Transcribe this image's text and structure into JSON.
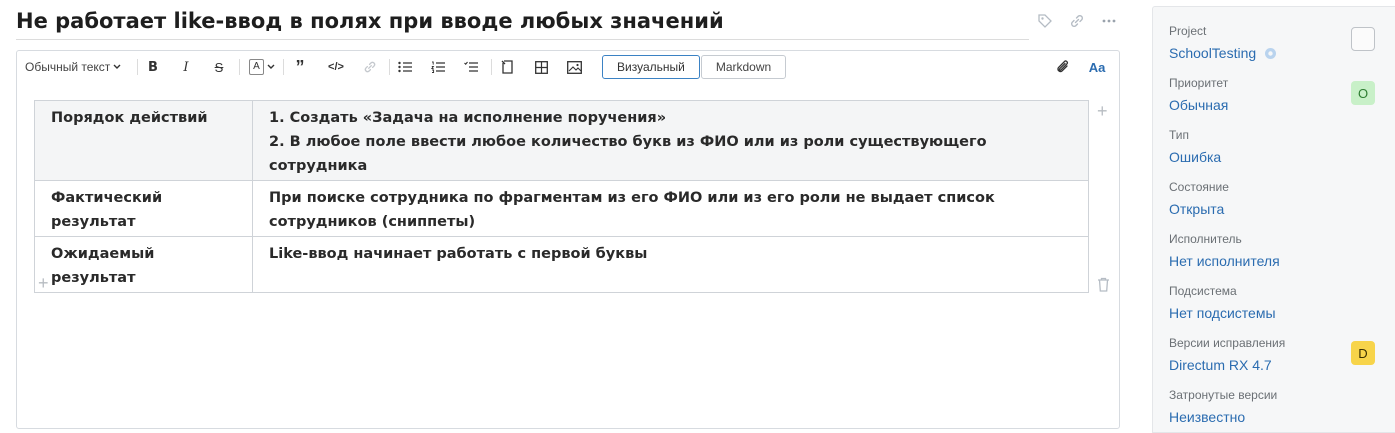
{
  "issue": {
    "title": "Не работает like-ввод в полях при вводе любых значений"
  },
  "toolbar": {
    "style_select": "Обычный текст",
    "modes": [
      "Визуальный",
      "Markdown"
    ],
    "font_toggle": "Aa"
  },
  "table": {
    "rows": [
      {
        "label": "Порядок действий",
        "lines": [
          "1. Создать «Задача на исполнение поручения»",
          "2. В любое поле ввести любое количество букв из ФИО или из роли существующего сотрудника"
        ]
      },
      {
        "label": "Фактический результат",
        "lines": [
          "При поиске сотрудника по фрагментам из его ФИО или из его роли не выдает список сотрудников (сниппеты)"
        ]
      },
      {
        "label": "Ожидаемый результат",
        "lines": [
          "Like-ввод начинает работать с первой буквы"
        ]
      }
    ]
  },
  "sidebar": {
    "fields": [
      {
        "label": "Project",
        "value": "SchoolTesting",
        "badge": ""
      },
      {
        "label": "Приоритет",
        "value": "Обычная",
        "badge": "O"
      },
      {
        "label": "Тип",
        "value": "Ошибка",
        "badge": null
      },
      {
        "label": "Состояние",
        "value": "Открыта",
        "badge": null
      },
      {
        "label": "Исполнитель",
        "value": "Нет исполнителя",
        "badge": null
      },
      {
        "label": "Подсистема",
        "value": "Нет подсистемы",
        "badge": null
      },
      {
        "label": "Версии исправления",
        "value": "Directum RX 4.7",
        "badge": "D"
      },
      {
        "label": "Затронутые версии",
        "value": "Неизвестно",
        "badge": null
      }
    ]
  },
  "colors": {
    "link": "#2b6cb0",
    "badge_priority": "#c8f0c8",
    "badge_version": "#f7d44a"
  }
}
